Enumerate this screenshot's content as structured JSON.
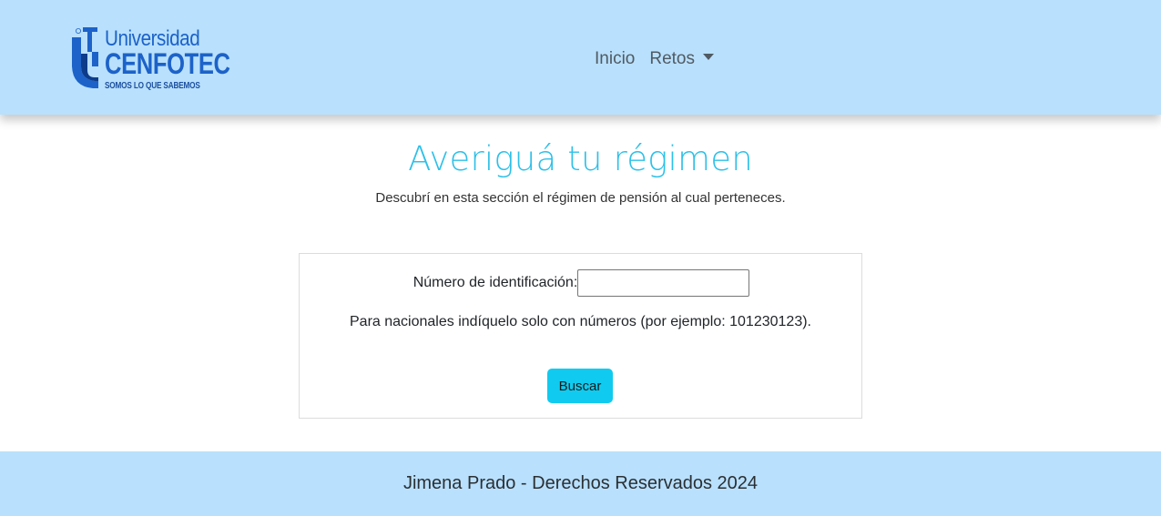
{
  "header": {
    "logo": {
      "line1": "Universidad",
      "line2": "CENFOTEC",
      "line3": "SOMOS LO QUE SABEMOS",
      "brand_color": "#1c62c9"
    },
    "nav": [
      {
        "label": "Inicio"
      },
      {
        "label": "Retos",
        "dropdown": true
      }
    ],
    "background_color": "#b9e0fc"
  },
  "main": {
    "title": "Averiguá tu régimen",
    "subtitle": "Descubrí en esta sección el régimen de pensión al cual perteneces.",
    "title_color": "#2ec0e8",
    "form": {
      "id_label": "Número de identificación:",
      "id_value": "",
      "hint": "Para nacionales indíquelo solo con números (por ejemplo: 101230123).",
      "button_label": "Buscar",
      "button_color": "#10cbef"
    }
  },
  "footer": {
    "text": "Jimena Prado - Derechos Reservados 2024"
  }
}
